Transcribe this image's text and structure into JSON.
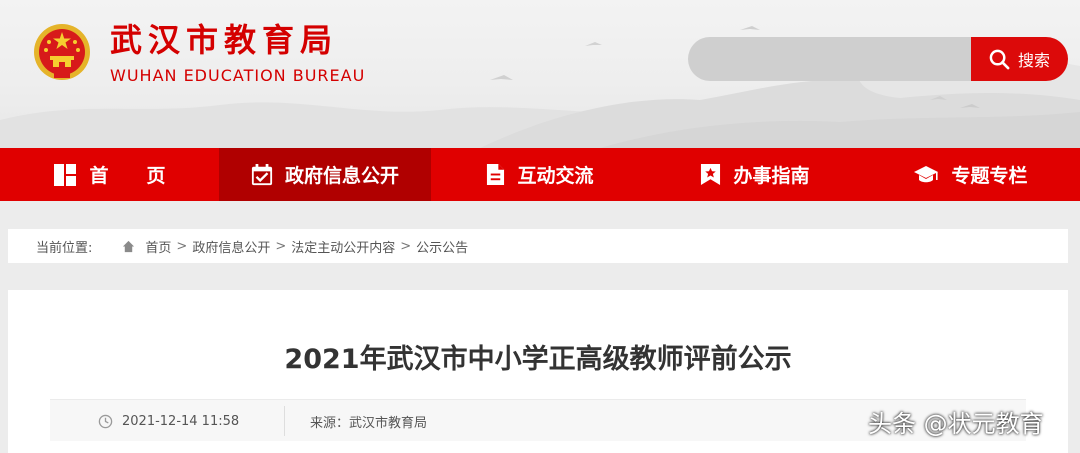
{
  "header": {
    "site_name_cn": "武汉市教育局",
    "site_name_en": "WUHAN EDUCATION BUREAU",
    "emblem": "national-emblem-icon"
  },
  "search": {
    "placeholder": "",
    "value": "",
    "button_label": "搜索",
    "icon": "search-icon"
  },
  "nav": {
    "items": [
      {
        "label": "首　　页",
        "icon": "home-grid-icon",
        "active": false
      },
      {
        "label": "政府信息公开",
        "icon": "calendar-check-icon",
        "active": true
      },
      {
        "label": "互动交流",
        "icon": "document-icon",
        "active": false
      },
      {
        "label": "办事指南",
        "icon": "bookmark-star-icon",
        "active": false
      },
      {
        "label": "专题专栏",
        "icon": "graduation-cap-icon",
        "active": false
      }
    ]
  },
  "breadcrumb": {
    "prefix": "当前位置:",
    "items": [
      "首页",
      "政府信息公开",
      "法定主动公开内容",
      "公示公告"
    ],
    "separator": ">"
  },
  "article": {
    "title": "2021年武汉市中小学正高级教师评前公示",
    "date": "2021-12-14 11:58",
    "source": "来源：武汉市教育局"
  },
  "watermark": "头条 @状元教育",
  "colors": {
    "primary_red": "#e00000",
    "active_nav": "#b00000",
    "header_bg": "#eeeeee",
    "page_bg": "#ececec"
  }
}
